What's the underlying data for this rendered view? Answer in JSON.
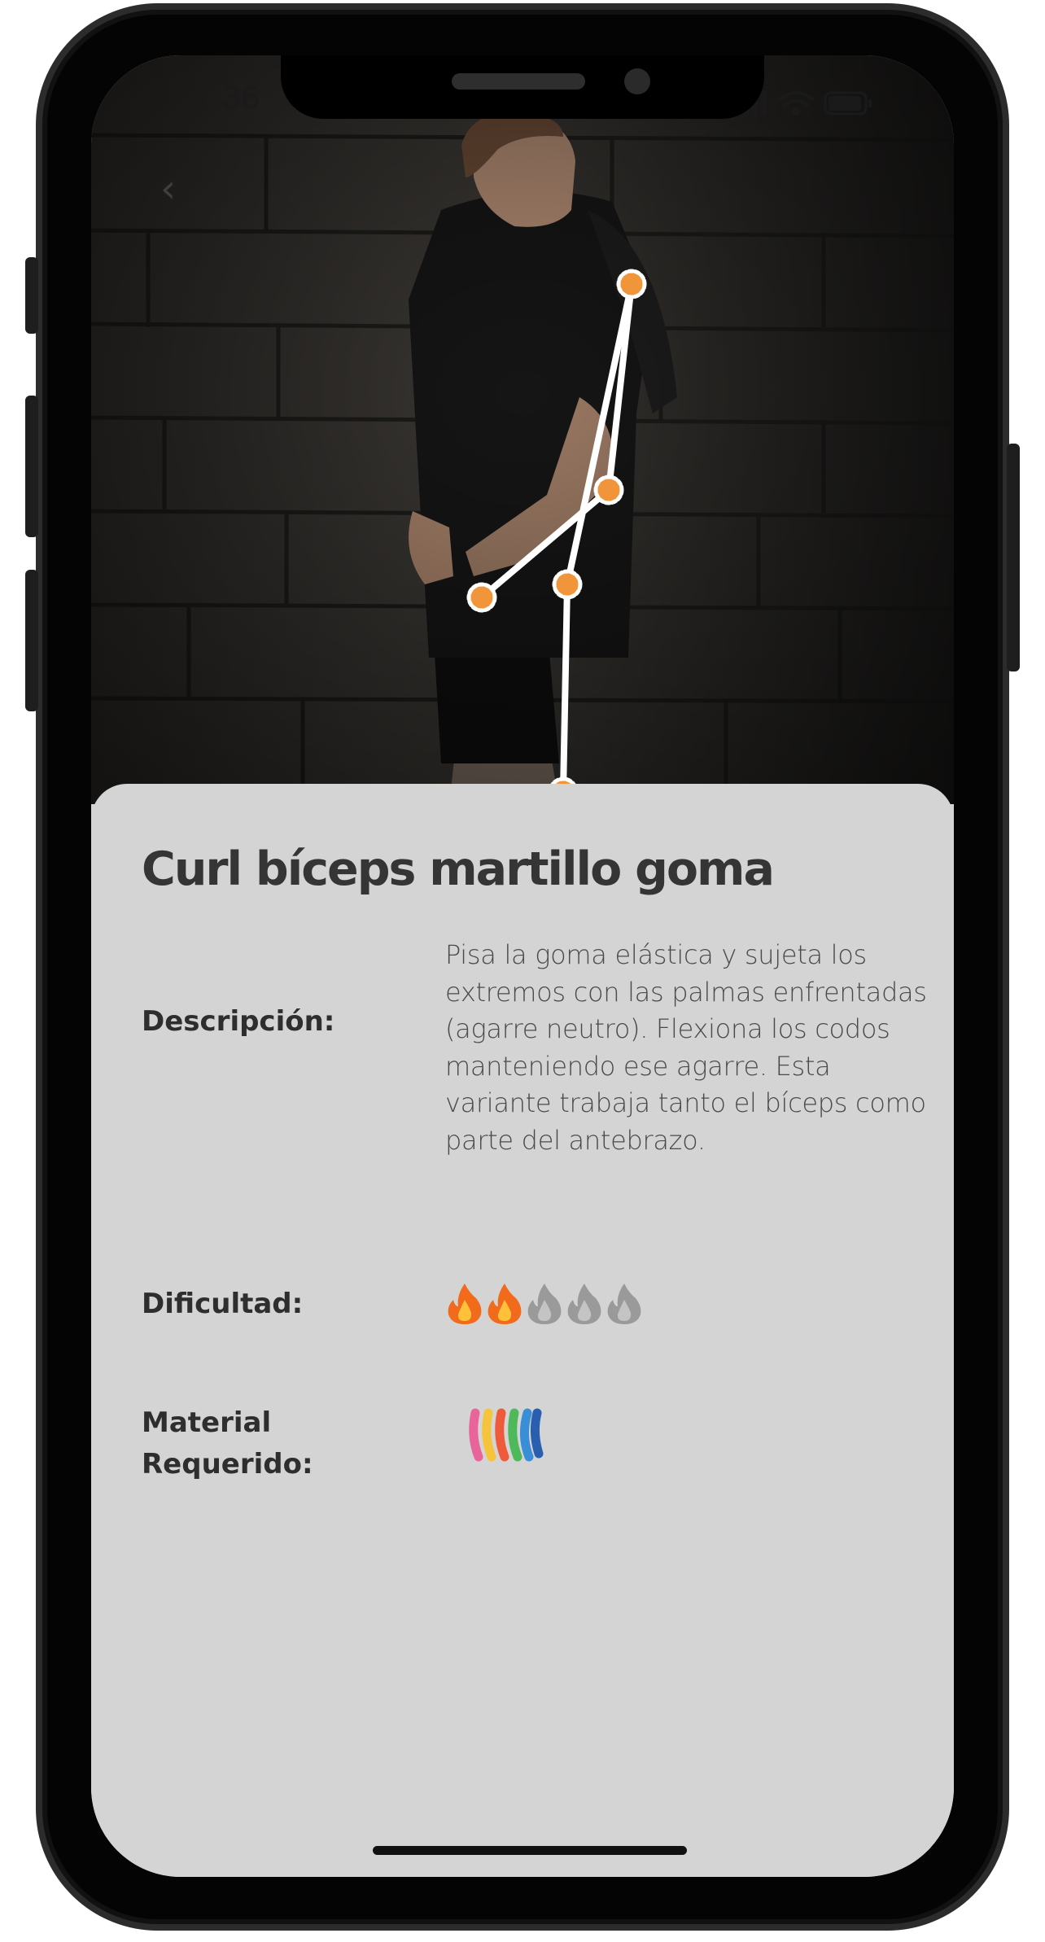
{
  "status_bar": {
    "time": "11:36"
  },
  "exercise": {
    "title": "Curl bíceps martillo goma",
    "description_label": "Descripción:",
    "description": "Pisa la goma elástica y sujeta los extremos con las palmas enfrentadas (agarre neutro). Flexiona los codos manteniendo ese agarre. Esta variante trabaja tanto el bíceps como parte del antebrazo.",
    "difficulty_label": "Dificultad:",
    "difficulty": {
      "level": 2,
      "max": 5
    },
    "material_label": "Material Requerido:",
    "material_icon": "resistance-bands-icon"
  },
  "colors": {
    "sheet": "#d4d4d4",
    "pose_joint": "#f0953a",
    "flame_active": "#f26b1d",
    "flame_inactive": "#9a9a9a"
  }
}
